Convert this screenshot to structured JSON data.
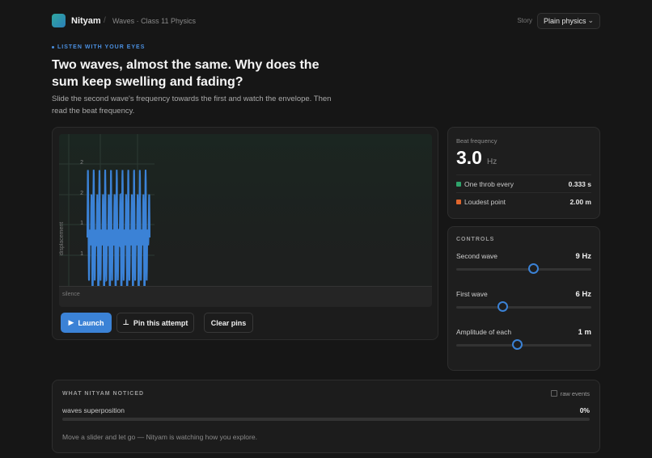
{
  "header": {
    "brand": "Nityam",
    "separator": "/",
    "breadcrumb": "Waves · Class 11 Physics",
    "story_label": "Story",
    "story_value": "Plain physics"
  },
  "hero": {
    "eyebrow": "LISTEN WITH YOUR EYES",
    "headline": "Two waves, almost the same. Why does the sum keep swelling and fading?",
    "subtext": "Slide the second wave's frequency towards the first and watch the envelope. Then read the beat frequency."
  },
  "simulation": {
    "y_axis_label": "displacement",
    "y_ticks": [
      "2",
      "2",
      "1",
      "1"
    ],
    "silence_label": "silence",
    "wave_color": "#3b82d6",
    "buttons": {
      "launch": "Launch",
      "pin": "Pin this attempt",
      "clear": "Clear pins"
    }
  },
  "beat": {
    "label": "Beat frequency",
    "value": "3.0",
    "unit": "Hz",
    "rows": [
      {
        "key": "One throb every",
        "value": "0.333 s",
        "color": "#2fa36b"
      },
      {
        "key": "Loudest point",
        "value": "2.00 m",
        "color": "#e0662d"
      }
    ]
  },
  "controls": {
    "title": "CONTROLS",
    "sliders": [
      {
        "label": "Second wave",
        "value": "9 Hz",
        "fraction": 0.57
      },
      {
        "label": "First wave",
        "value": "6 Hz",
        "fraction": 0.34
      },
      {
        "label": "Amplitude of each",
        "value": "1 m",
        "fraction": 0.45
      }
    ]
  },
  "notice": {
    "title": "WHAT NITYAM NOTICED",
    "raw_events": "raw events",
    "progress_label": "waves superposition",
    "progress_value": "0%",
    "progress_fraction": 0,
    "message": "Move a slider and let go — Nityam is watching how you explore."
  }
}
